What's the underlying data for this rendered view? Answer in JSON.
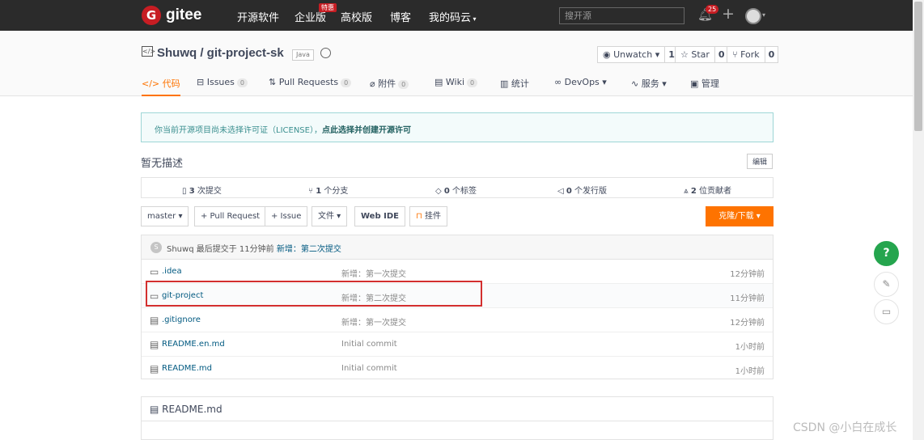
{
  "topbar": {
    "logo_letter": "G",
    "logo_text": "gitee",
    "nav": [
      "开源软件",
      "企业版",
      "高校版",
      "博客",
      "我的码云"
    ],
    "hot_badge": "特惠",
    "search_placeholder": "搜开源",
    "notifications": "25"
  },
  "repo": {
    "icon": "</>",
    "title": "Shuwq / git-project-sk",
    "language": "Java",
    "watch_label": "Unwatch ▾",
    "watch_count": "1",
    "star_label": "☆ Star",
    "star_count": "0",
    "fork_label": "Fork",
    "fork_count": "0"
  },
  "tabs": [
    {
      "label": "</> 代码",
      "badge": ""
    },
    {
      "label": "Issues",
      "badge": "0"
    },
    {
      "label": "Pull Requests",
      "badge": "0"
    },
    {
      "label": "附件",
      "badge": "0"
    },
    {
      "label": "Wiki",
      "badge": "0"
    },
    {
      "label": "统计",
      "badge": ""
    },
    {
      "label": "DevOps ▾",
      "badge": ""
    },
    {
      "label": "服务 ▾",
      "badge": ""
    },
    {
      "label": "管理",
      "badge": ""
    }
  ],
  "license": {
    "text": "你当前开源项目尚未选择许可证（LICENSE），",
    "link": "点此选择并创建开源许可"
  },
  "description": "暂无描述",
  "edit_label": "编辑",
  "stats": {
    "commits_num": "3",
    "commits_label": "次提交",
    "branches_num": "1",
    "branches_label": "个分支",
    "tags_num": "0",
    "tags_label": "个标签",
    "releases_num": "0",
    "releases_label": "个发行版",
    "contributors_num": "2",
    "contributors_label": "位贡献者"
  },
  "toolbar": {
    "branch": "master ▾",
    "pull_request": "+ Pull Request",
    "issue": "+ Issue",
    "file": "文件 ▾",
    "webide": "Web IDE",
    "widget": "挂件",
    "clone": "克隆/下载 ▾"
  },
  "last_commit": {
    "avatar": "S",
    "text": "Shuwq 最后提交于 11分钟前",
    "message": "新增：第二次提交"
  },
  "files": [
    {
      "icon": "folder",
      "name": ".idea",
      "message": "新增：第一次提交",
      "time": "12分钟前"
    },
    {
      "icon": "folder",
      "name": "git-project",
      "message": "新增：第二次提交",
      "time": "11分钟前"
    },
    {
      "icon": "file",
      "name": ".gitignore",
      "message": "新增：第一次提交",
      "time": "12分钟前"
    },
    {
      "icon": "file",
      "name": "README.en.md",
      "message": "Initial commit",
      "time": "1小时前"
    },
    {
      "icon": "file",
      "name": "README.md",
      "message": "Initial commit",
      "time": "1小时前"
    }
  ],
  "readme_title": "README.md",
  "help_label": "?",
  "watermark": "CSDN @小白在成长"
}
